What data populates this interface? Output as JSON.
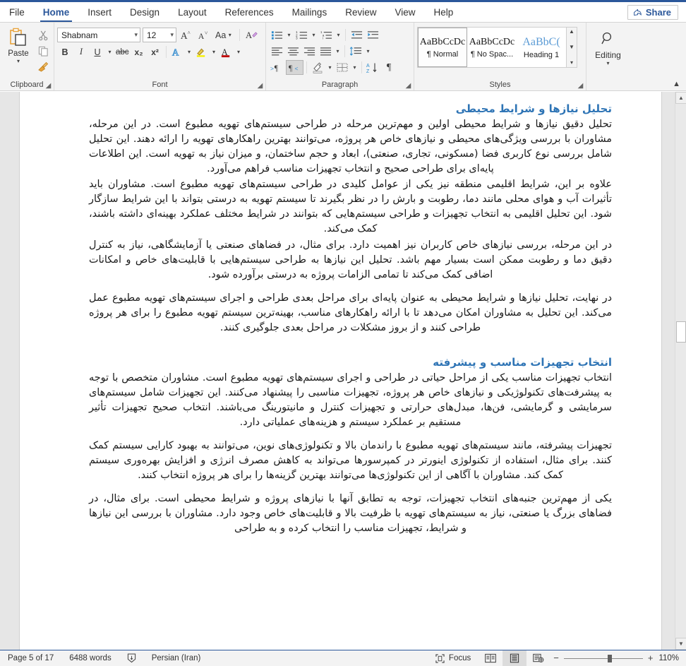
{
  "app": {
    "accent_color": "#2b579a",
    "heading_color": "#2e74b5"
  },
  "tabs": [
    {
      "label": "File",
      "active": false
    },
    {
      "label": "Home",
      "active": true
    },
    {
      "label": "Insert",
      "active": false
    },
    {
      "label": "Design",
      "active": false
    },
    {
      "label": "Layout",
      "active": false
    },
    {
      "label": "References",
      "active": false
    },
    {
      "label": "Mailings",
      "active": false
    },
    {
      "label": "Review",
      "active": false
    },
    {
      "label": "View",
      "active": false
    },
    {
      "label": "Help",
      "active": false
    }
  ],
  "share": {
    "label": "Share",
    "icon": "share-icon"
  },
  "ribbon": {
    "clipboard": {
      "group_label": "Clipboard",
      "paste_label": "Paste",
      "paste_icon": "paste-icon",
      "cut_icon": "scissors-icon",
      "copy_icon": "copy-icon",
      "format_painter_icon": "format-painter-icon",
      "dialog_launcher": "dialog-launcher-icon"
    },
    "font": {
      "group_label": "Font",
      "font_name": "Shabnam",
      "font_size": "12",
      "grow_font": "A^",
      "shrink_font": "A˅",
      "change_case": "Aa",
      "clear_formatting": "clear-formatting-icon",
      "bold": "B",
      "italic": "I",
      "underline": "U",
      "strikethrough": "abc",
      "subscript": "x₂",
      "superscript": "x²",
      "text_effects": "A",
      "highlight": "highlight-icon",
      "font_color": "A",
      "dialog_launcher": "dialog-launcher-icon"
    },
    "paragraph": {
      "group_label": "Paragraph",
      "bullets": "bullets-icon",
      "numbering": "numbering-icon",
      "multilevel": "multilevel-list-icon",
      "decrease_indent": "decrease-indent-icon",
      "increase_indent": "increase-indent-icon",
      "align_left": "align-left-icon",
      "center": "align-center-icon",
      "align_right": "align-right-icon",
      "justify": "justify-icon",
      "line_spacing": "line-spacing-icon",
      "ltr": "left-to-right-icon",
      "rtl": "right-to-left-icon",
      "shading": "shading-icon",
      "borders": "borders-icon",
      "sort": "sort-icon",
      "show_marks": "show-formatting-marks-icon",
      "dialog_launcher": "dialog-launcher-icon"
    },
    "styles": {
      "group_label": "Styles",
      "items": [
        {
          "preview": "AaBbCcDc",
          "name": "¶ Normal",
          "selected": true
        },
        {
          "preview": "AaBbCcDc",
          "name": "¶ No Spac...",
          "selected": false
        },
        {
          "preview": "AaBbC(",
          "name": "Heading 1",
          "selected": false
        }
      ],
      "dialog_launcher": "dialog-launcher-icon"
    },
    "editing": {
      "group_label": "",
      "label": "Editing",
      "icon": "magnifier-icon"
    },
    "collapse_icon": "chevron-up-icon"
  },
  "document": {
    "blocks": [
      {
        "type": "heading",
        "text": "تحلیل نیازها و شرایط محیطی"
      },
      {
        "type": "paragraph",
        "text": "تحلیل دقیق نیازها و شرایط محیطی اولین و مهم‌ترین مرحله در طراحی سیستم‌های تهویه مطبوع است. در این مرحله، مشاوران با بررسی ویژگی‌های محیطی و نیازهای خاص هر پروژه، می‌توانند بهترین راهکارهای تهویه را ارائه دهند. این تحلیل شامل بررسی نوع کاربری فضا (مسکونی، تجاری، صنعتی)، ابعاد و حجم ساختمان، و میزان نیاز به تهویه است. این اطلاعات پایه‌ای برای طراحی صحیح و انتخاب تجهیزات مناسب فراهم می‌آورد."
      },
      {
        "type": "paragraph",
        "text": "علاوه بر این، شرایط اقلیمی منطقه نیز یکی از عوامل کلیدی در طراحی سیستم‌های تهویه مطبوع است. مشاوران باید تأثیرات آب و هوای محلی مانند دما، رطوبت و بارش را در نظر بگیرند تا سیستم تهویه به درستی بتواند با این شرایط سازگار شود. این تحلیل اقلیمی به انتخاب تجهیزات و طراحی سیستم‌هایی که بتوانند در شرایط مختلف عملکرد بهینه‌ای داشته باشند، کمک می‌کند."
      },
      {
        "type": "paragraph",
        "text": "در این مرحله، بررسی نیازهای خاص کاربران نیز اهمیت دارد. برای مثال، در فضاهای صنعتی یا آزمایشگاهی، نیاز به کنترل دقیق دما و رطوبت ممکن است بسیار مهم باشد. تحلیل این نیازها به طراحی سیستم‌هایی با قابلیت‌های خاص و امکانات اضافی کمک می‌کند تا تمامی الزامات پروژه به درستی برآورده شود."
      },
      {
        "type": "paragraph",
        "gap": true,
        "text": "در نهایت، تحلیل نیازها و شرایط محیطی به عنوان پایه‌ای برای مراحل بعدی طراحی و اجرای سیستم‌های تهویه مطبوع عمل می‌کند. این تحلیل به مشاوران امکان می‌دهد تا با ارائه راهکارهای مناسب، بهینه‌ترین سیستم تهویه مطبوع را برای هر پروژه طراحی کنند و از بروز مشکلات در مراحل بعدی جلوگیری کنند."
      },
      {
        "type": "heading",
        "text": "انتخاب تجهیزات مناسب و پیشرفته"
      },
      {
        "type": "paragraph",
        "text": "انتخاب تجهیزات مناسب یکی از مراحل حیاتی در طراحی و اجرای سیستم‌های تهویه مطبوع است. مشاوران متخصص با توجه به پیشرفت‌های تکنولوژیکی و نیازهای خاص هر پروژه، تجهیزات مناسبی را پیشنهاد می‌کنند. این تجهیزات شامل سیستم‌های سرمایشی و گرمایشی، فن‌ها، مبدل‌های حرارتی و تجهیزات کنترل و مانیتورینگ می‌باشند. انتخاب صحیح تجهیزات تأثیر مستقیم بر عملکرد سیستم و هزینه‌های عملیاتی دارد."
      },
      {
        "type": "paragraph",
        "gap": true,
        "text": "تجهیزات پیشرفته، مانند سیستم‌های تهویه مطبوع با راندمان بالا و تکنولوژی‌های نوین، می‌توانند به بهبود کارایی سیستم کمک کنند. برای مثال، استفاده از تکنولوژی اینورتر در کمپرسورها می‌تواند به کاهش مصرف انرژی و افزایش بهره‌وری سیستم کمک کند. مشاوران با آگاهی از این تکنولوژی‌ها می‌توانند بهترین گزینه‌ها را برای هر پروژه انتخاب کنند."
      },
      {
        "type": "paragraph",
        "gap": true,
        "text": "یکی از مهم‌ترین جنبه‌های انتخاب تجهیزات، توجه به تطابق آنها با نیازهای پروژه و شرایط محیطی است. برای مثال، در فضاهای بزرگ یا صنعتی، نیاز به سیستم‌های تهویه با ظرفیت بالا و قابلیت‌های خاص وجود دارد. مشاوران با بررسی این نیازها و شرایط، تجهیزات مناسب را انتخاب کرده و به طراحی"
      }
    ]
  },
  "statusbar": {
    "page": "Page 5 of 17",
    "words": "6488 words",
    "proofing_icon": "proofing-icon",
    "language": "Persian (Iran)",
    "focus_label": "Focus",
    "focus_icon": "focus-icon",
    "view_read": "read-mode-icon",
    "view_print": "print-layout-icon",
    "view_web": "web-layout-icon",
    "zoom_out": "−",
    "zoom_in": "+",
    "zoom_level": "110%"
  },
  "scrollbar": {
    "up_arrow": "scroll-up-icon",
    "down_arrow": "scroll-down-icon",
    "thumb": "scroll-thumb"
  }
}
